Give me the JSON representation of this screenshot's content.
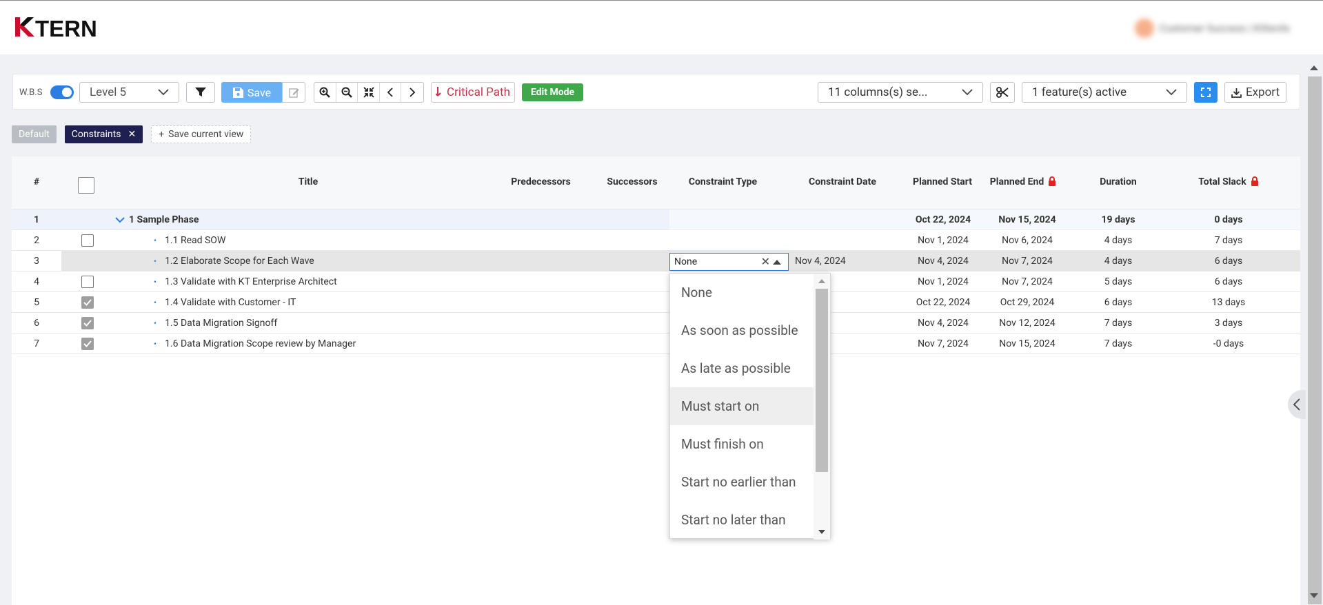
{
  "header": {
    "logo_text": "KTERN",
    "user_name": "Customer Success | Kittevils"
  },
  "toolbar": {
    "wbs_label": "W.B.S",
    "wbs_enabled": true,
    "level_value": "Level 5",
    "save_label": "Save",
    "critical_path_label": "Critical Path",
    "edit_mode_label": "Edit Mode",
    "columns_value": "11 columns(s) se...",
    "features_value": "1 feature(s) active",
    "export_label": "Export",
    "accent_color": "#2a8df0",
    "critical_color": "#c8344a",
    "edit_mode_color": "#3fa84a"
  },
  "views": {
    "default_label": "Default",
    "active_label": "Constraints",
    "save_label": "Save current view"
  },
  "grid": {
    "columns": {
      "num": "#",
      "title": "Title",
      "predecessors": "Predecessors",
      "successors": "Successors",
      "constraint_type": "Constraint Type",
      "constraint_date": "Constraint Date",
      "planned_start": "Planned Start",
      "planned_end": "Planned End",
      "duration": "Duration",
      "total_slack": "Total Slack"
    },
    "rows": [
      {
        "num": "1",
        "title": "1 Sample Phase",
        "planned_start": "Oct 22, 2024",
        "planned_end": "Nov 15, 2024",
        "duration": "19 days",
        "total_slack": "0 days"
      },
      {
        "num": "2",
        "title": "1.1 Read SOW",
        "planned_start": "Nov 1, 2024",
        "planned_end": "Nov 6, 2024",
        "duration": "4 days",
        "total_slack": "7 days"
      },
      {
        "num": "3",
        "title": "1.2 Elaborate Scope for Each Wave",
        "constraint_type": "None",
        "constraint_date": "Nov 4, 2024",
        "planned_start": "Nov 4, 2024",
        "planned_end": "Nov 7, 2024",
        "duration": "4 days",
        "total_slack": "6 days"
      },
      {
        "num": "4",
        "title": "1.3 Validate with KT Enterprise Architect",
        "planned_start": "Nov 1, 2024",
        "planned_end": "Nov 7, 2024",
        "duration": "5 days",
        "total_slack": "6 days"
      },
      {
        "num": "5",
        "title": "1.4 Validate with Customer - IT",
        "planned_start": "Oct 22, 2024",
        "planned_end": "Oct 29, 2024",
        "duration": "6 days",
        "total_slack": "13 days"
      },
      {
        "num": "6",
        "title": "1.5 Data Migration Signoff",
        "planned_start": "Nov 4, 2024",
        "planned_end": "Nov 12, 2024",
        "duration": "7 days",
        "total_slack": "3 days"
      },
      {
        "num": "7",
        "title": "1.6 Data Migration Scope review by Manager",
        "planned_start": "Nov 7, 2024",
        "planned_end": "Nov 15, 2024",
        "duration": "7 days",
        "total_slack": "-0 days"
      }
    ]
  },
  "constraint_dropdown": {
    "selected": "None",
    "options": [
      "None",
      "As soon as possible",
      "As late as possible",
      "Must start on",
      "Must finish on",
      "Start no earlier than",
      "Start no later than"
    ],
    "hovered": "Must start on"
  }
}
